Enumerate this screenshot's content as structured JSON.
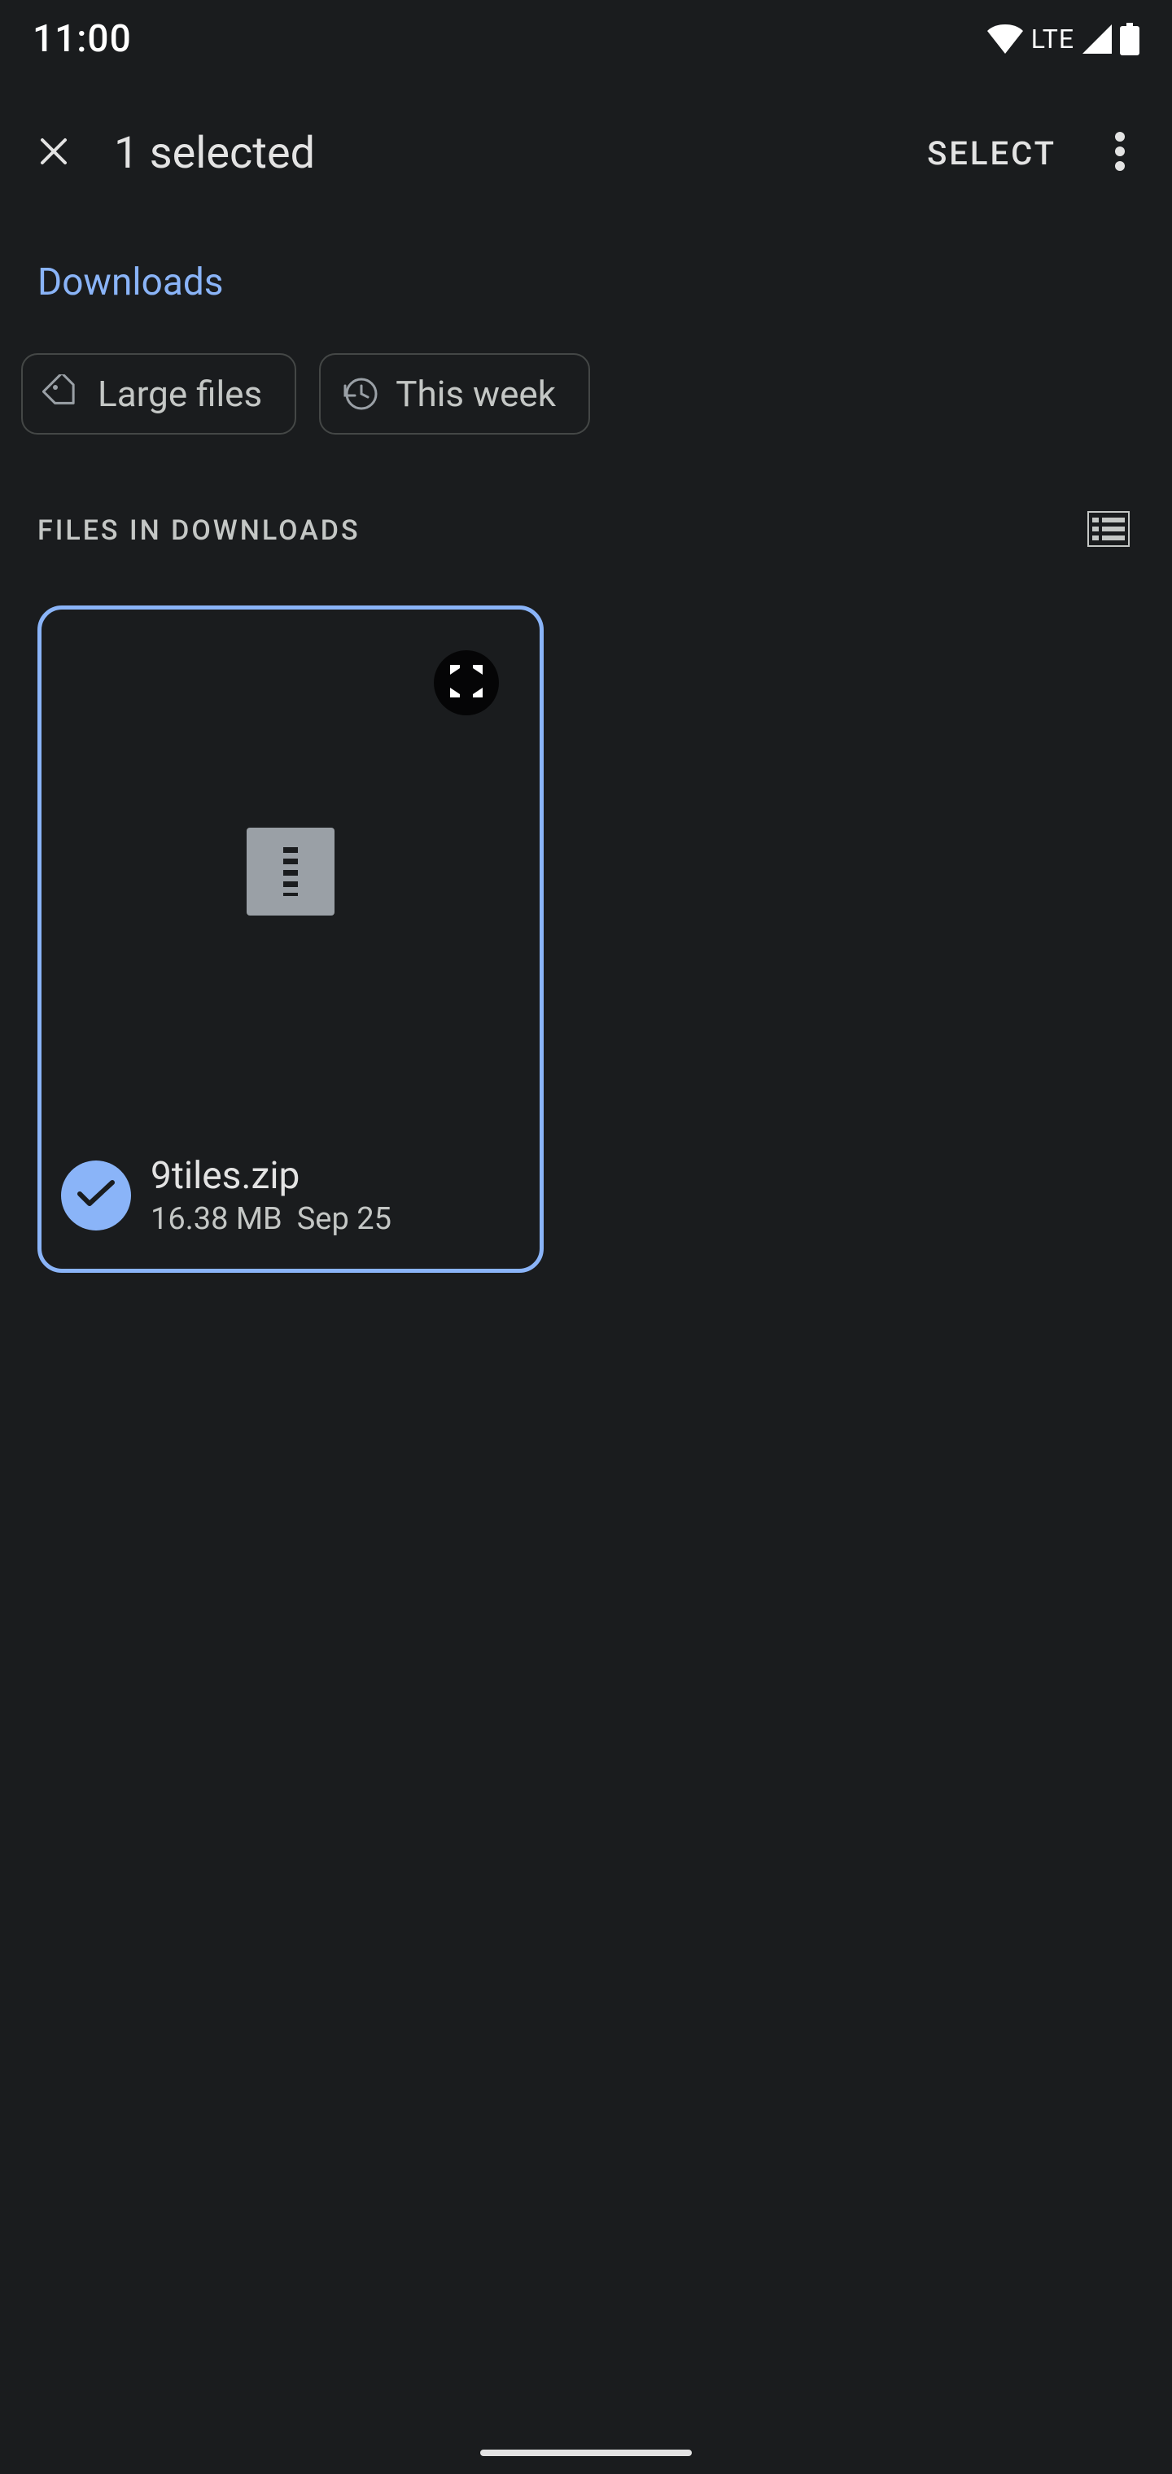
{
  "status": {
    "time": "11:00",
    "lte": "LTE"
  },
  "appBar": {
    "title": "1 selected",
    "selectLabel": "SELECT"
  },
  "breadcrumb": {
    "label": "Downloads"
  },
  "filters": {
    "largeFiles": "Large files",
    "thisWeek": "This week"
  },
  "section": {
    "title": "FILES IN DOWNLOADS"
  },
  "files": [
    {
      "name": "9tiles.zip",
      "size": "16.38 MB",
      "date": "Sep 25",
      "selected": true,
      "type": "zip"
    }
  ],
  "colors": {
    "accent": "#8ab4f8",
    "background": "#1a1c1e"
  }
}
